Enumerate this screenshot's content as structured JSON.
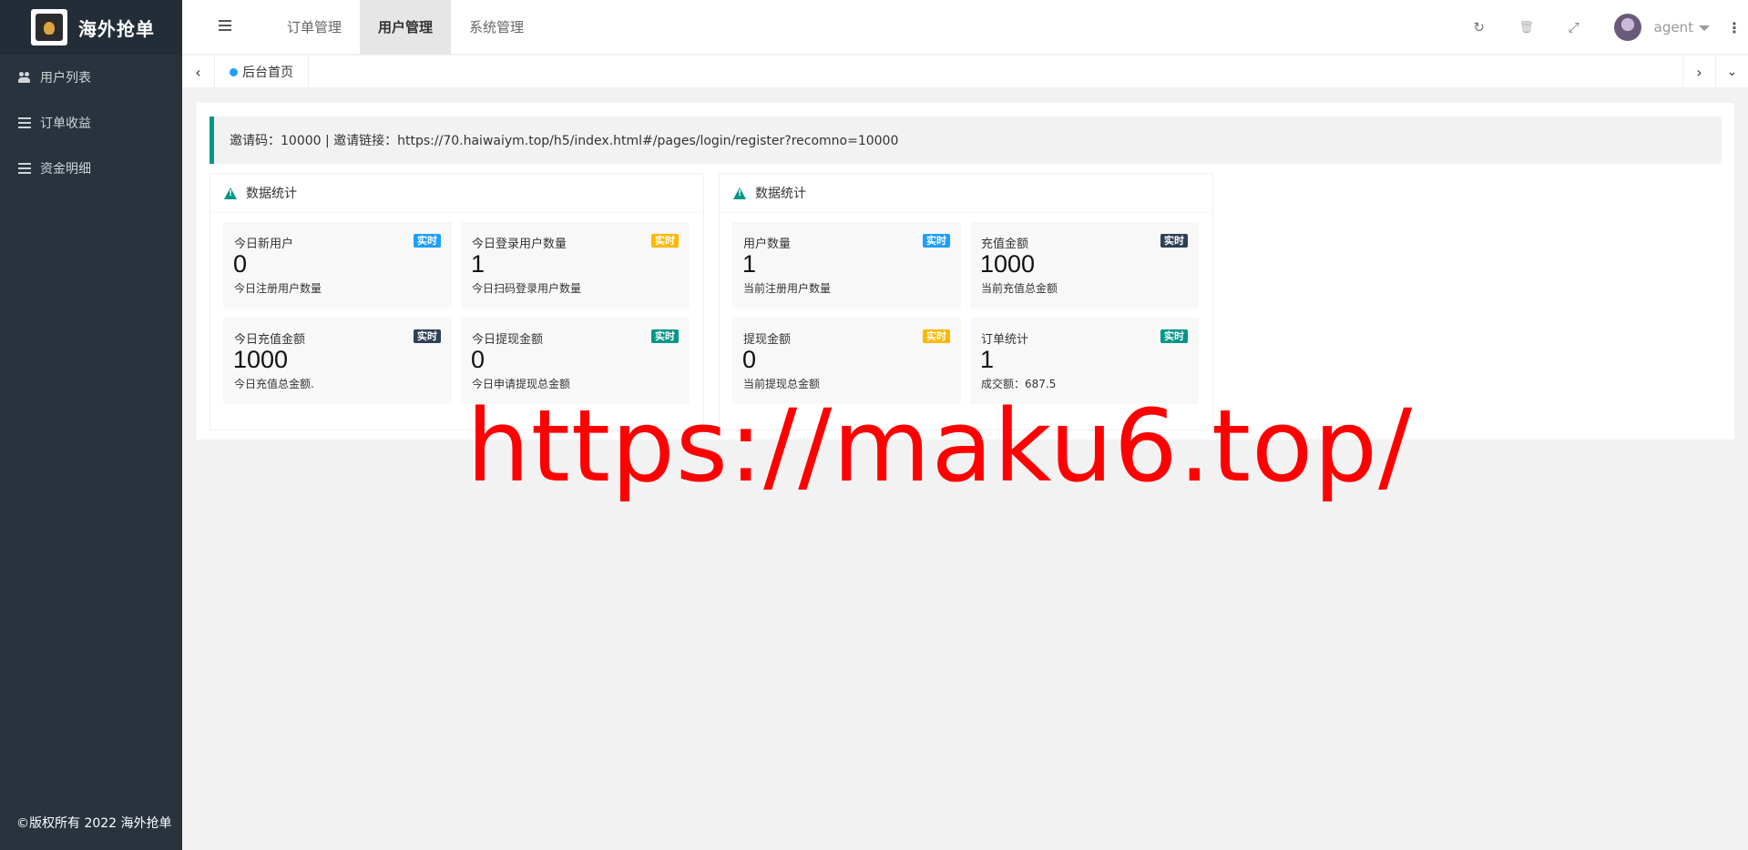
{
  "brand": {
    "name": "海外抢单"
  },
  "sidebar": {
    "items": [
      {
        "label": "用户列表",
        "icon": "users-icon"
      },
      {
        "label": "订单收益",
        "icon": "list-icon"
      },
      {
        "label": "资金明细",
        "icon": "list-icon"
      }
    ],
    "footer": "©版权所有 2022 海外抢单"
  },
  "header": {
    "nav": [
      {
        "label": "订单管理"
      },
      {
        "label": "用户管理",
        "active": true
      },
      {
        "label": "系统管理"
      }
    ],
    "icons": {
      "refresh": "↻",
      "trash": "🗑",
      "fullscreen": "⤢",
      "more": "⋮"
    },
    "user": "agent"
  },
  "tabs": {
    "home": "后台首页",
    "prev": "‹",
    "next": "›",
    "down": "⌄"
  },
  "invite": {
    "text": "邀请码：10000 | 邀请链接：https://70.haiwaiym.top/h5/index.html#/pages/login/register?recomno=10000"
  },
  "colors": {
    "blue": "#1e9fff",
    "yellow": "#ffb800",
    "dark": "#2f4056",
    "green": "#009688"
  },
  "panels": [
    {
      "title": "数据统计",
      "stats": [
        {
          "label": "今日新用户",
          "badge": "实时",
          "badge_color": "#1e9fff",
          "value": "0",
          "desc": "今日注册用户数量"
        },
        {
          "label": "今日登录用户数量",
          "badge": "实时",
          "badge_color": "#ffb800",
          "value": "1",
          "desc": "今日扫码登录用户数量"
        },
        {
          "label": "今日充值金额",
          "badge": "实时",
          "badge_color": "#2f4056",
          "value": "1000",
          "desc": "今日充值总金额."
        },
        {
          "label": "今日提现金额",
          "badge": "实时",
          "badge_color": "#009688",
          "value": "0",
          "desc": "今日申请提现总金额"
        }
      ]
    },
    {
      "title": "数据统计",
      "stats": [
        {
          "label": "用户数量",
          "badge": "实时",
          "badge_color": "#1e9fff",
          "value": "1",
          "desc": "当前注册用户数量"
        },
        {
          "label": "充值金额",
          "badge": "实时",
          "badge_color": "#2f4056",
          "value": "1000",
          "desc": "当前充值总金额"
        },
        {
          "label": "提现金额",
          "badge": "实时",
          "badge_color": "#ffb800",
          "value": "0",
          "desc": "当前提现总金额"
        },
        {
          "label": "订单统计",
          "badge": "实时",
          "badge_color": "#009688",
          "value": "1",
          "desc": "成交额：687.5"
        }
      ]
    }
  ],
  "watermark": "https://maku6.top/"
}
